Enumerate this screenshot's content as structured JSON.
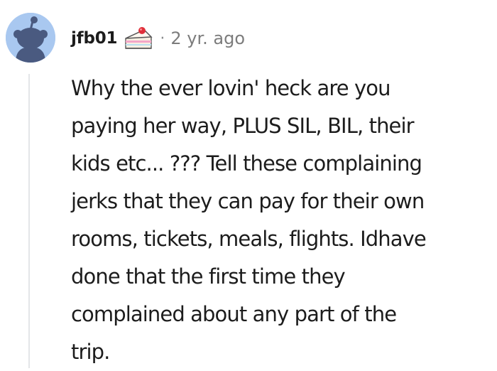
{
  "comment": {
    "username": "jfb01",
    "flair_icon": "cake-slice-icon",
    "separator": "·",
    "timestamp": "2 yr. ago",
    "body_lines": [
      "Why the ever lovin' heck are you",
      "paying her way, PLUS SIL, BIL, their",
      "kids etc... ??? Tell these complaining",
      "jerks that they can pay for their own",
      "rooms, tickets, meals, flights. Idhave",
      "done that the first time they",
      "complained about any part of the",
      "trip."
    ]
  },
  "colors": {
    "avatar_bg": "#a9c8f0",
    "avatar_figure": "#4a5a80",
    "text": "#1c1c1c",
    "meta_text": "#7c7c7c",
    "thread_line": "#e4e6e8"
  }
}
